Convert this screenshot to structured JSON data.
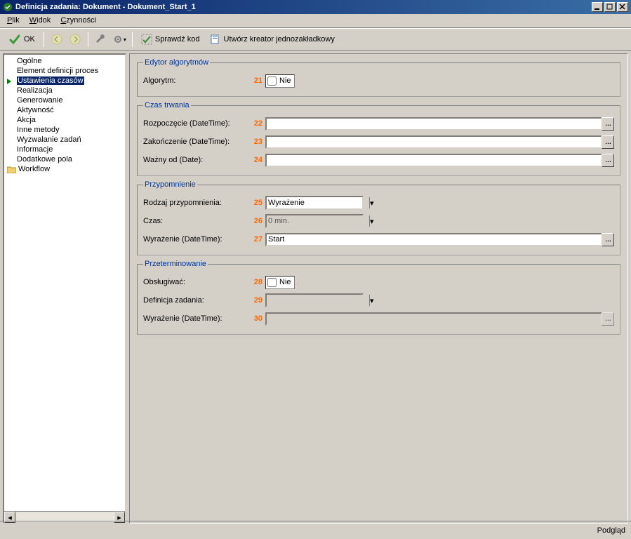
{
  "window": {
    "title": "Definicja zadania: Dokument - Dokument_Start_1"
  },
  "menu": {
    "plik": "Plik",
    "widok": "Widok",
    "czynnosci": "Czynności"
  },
  "toolbar": {
    "ok": "OK",
    "sprawdz_kod": "Sprawdź kod",
    "utworz_kreator": "Utwórz kreator jednozakładkowy"
  },
  "sidebar": {
    "items": [
      "Ogólne",
      "Element definicji proces",
      "Ustawienia czasów",
      "Realizacja",
      "Generowanie",
      "Aktywność",
      "Akcja",
      "Inne metody",
      "Wyzwalanie zadań",
      "Informacje",
      "Dodatkowe pola"
    ],
    "workflow": "Workflow"
  },
  "labels": {
    "edytor_alg": "Edytor algorytmów",
    "algorytm": "Algorytm:",
    "nie": "Nie",
    "czas_trwania": "Czas trwania",
    "rozpoczecie": "Rozpoczęcie (DateTime):",
    "zakonczenie": "Zakończenie (DateTime):",
    "wazny_od": "Ważny od (Date):",
    "przypomnienie": "Przypomnienie",
    "rodzaj_przyp": "Rodzaj przypomnienia:",
    "czas": "Czas:",
    "wyrazenie_dt": "Wyrażenie (DateTime):",
    "przeterminowanie": "Przeterminowanie",
    "obslugiwac": "Obsługiwać:",
    "definicja_zadania": "Definicja zadania:"
  },
  "values": {
    "n21": "21",
    "n22": "22",
    "n23": "23",
    "n24": "24",
    "n25": "25",
    "n26": "26",
    "n27": "27",
    "n28": "28",
    "n29": "29",
    "n30": "30",
    "rodzaj_przyp_val": "Wyrażenie",
    "czas_val": "0 min.",
    "wyrazenie_val": "Start",
    "rozpoczecie_val": "",
    "zakonczenie_val": "",
    "wazny_od_val": "",
    "definicja_zadania_val": "",
    "wyrazenie_dt2_val": ""
  },
  "status": {
    "podglad": "Podgląd"
  }
}
